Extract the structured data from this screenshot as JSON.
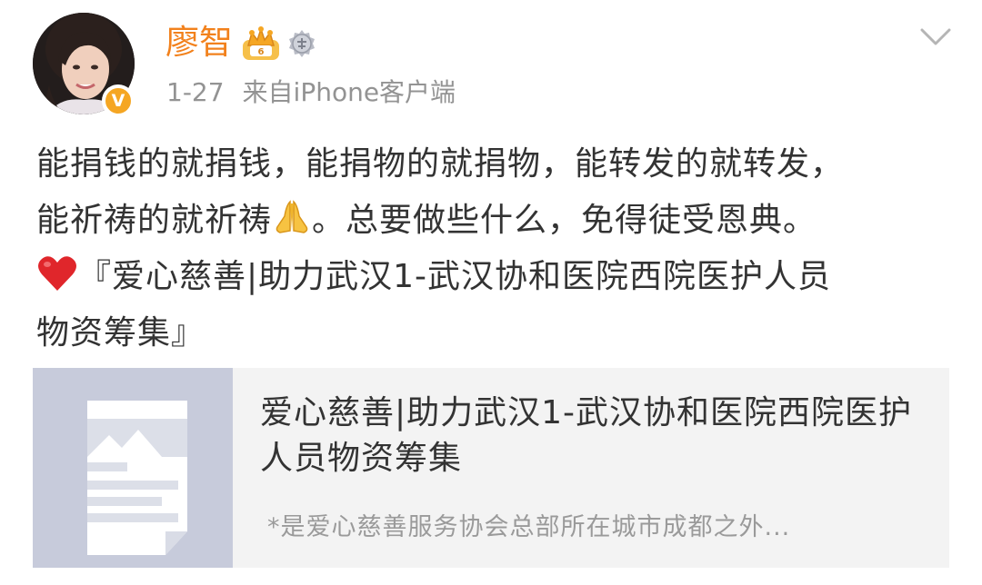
{
  "post": {
    "author": {
      "name": "廖智",
      "avatar_icon": "avatar",
      "verified_badge": "V",
      "verified_color": "#f5a623",
      "name_color": "#f2811c"
    },
    "meta": {
      "date": "1-27",
      "source": "来自iPhone客户端"
    },
    "content": {
      "line1": "能捐钱的就捐钱，能捐物的就捐物，能转发的就转发，",
      "line2_before_emoji": "能祈祷的就祈祷",
      "line2_emoji": "folded-hands",
      "line2_after_emoji": "。总要做些什么，免得徒受恩典。",
      "line3_emoji": "red-heart",
      "line3_text": "『爱心慈善|助力武汉1-武汉协和医院西院医护人员",
      "line4_text": "物资筹集』"
    },
    "link_card": {
      "thumbnail_icon": "document-icon",
      "title": "爱心慈善|助力武汉1-武汉协和医院西院医护人员物资筹集",
      "description": "*是爱心慈善服务协会总部所在城市成都之外..."
    }
  }
}
